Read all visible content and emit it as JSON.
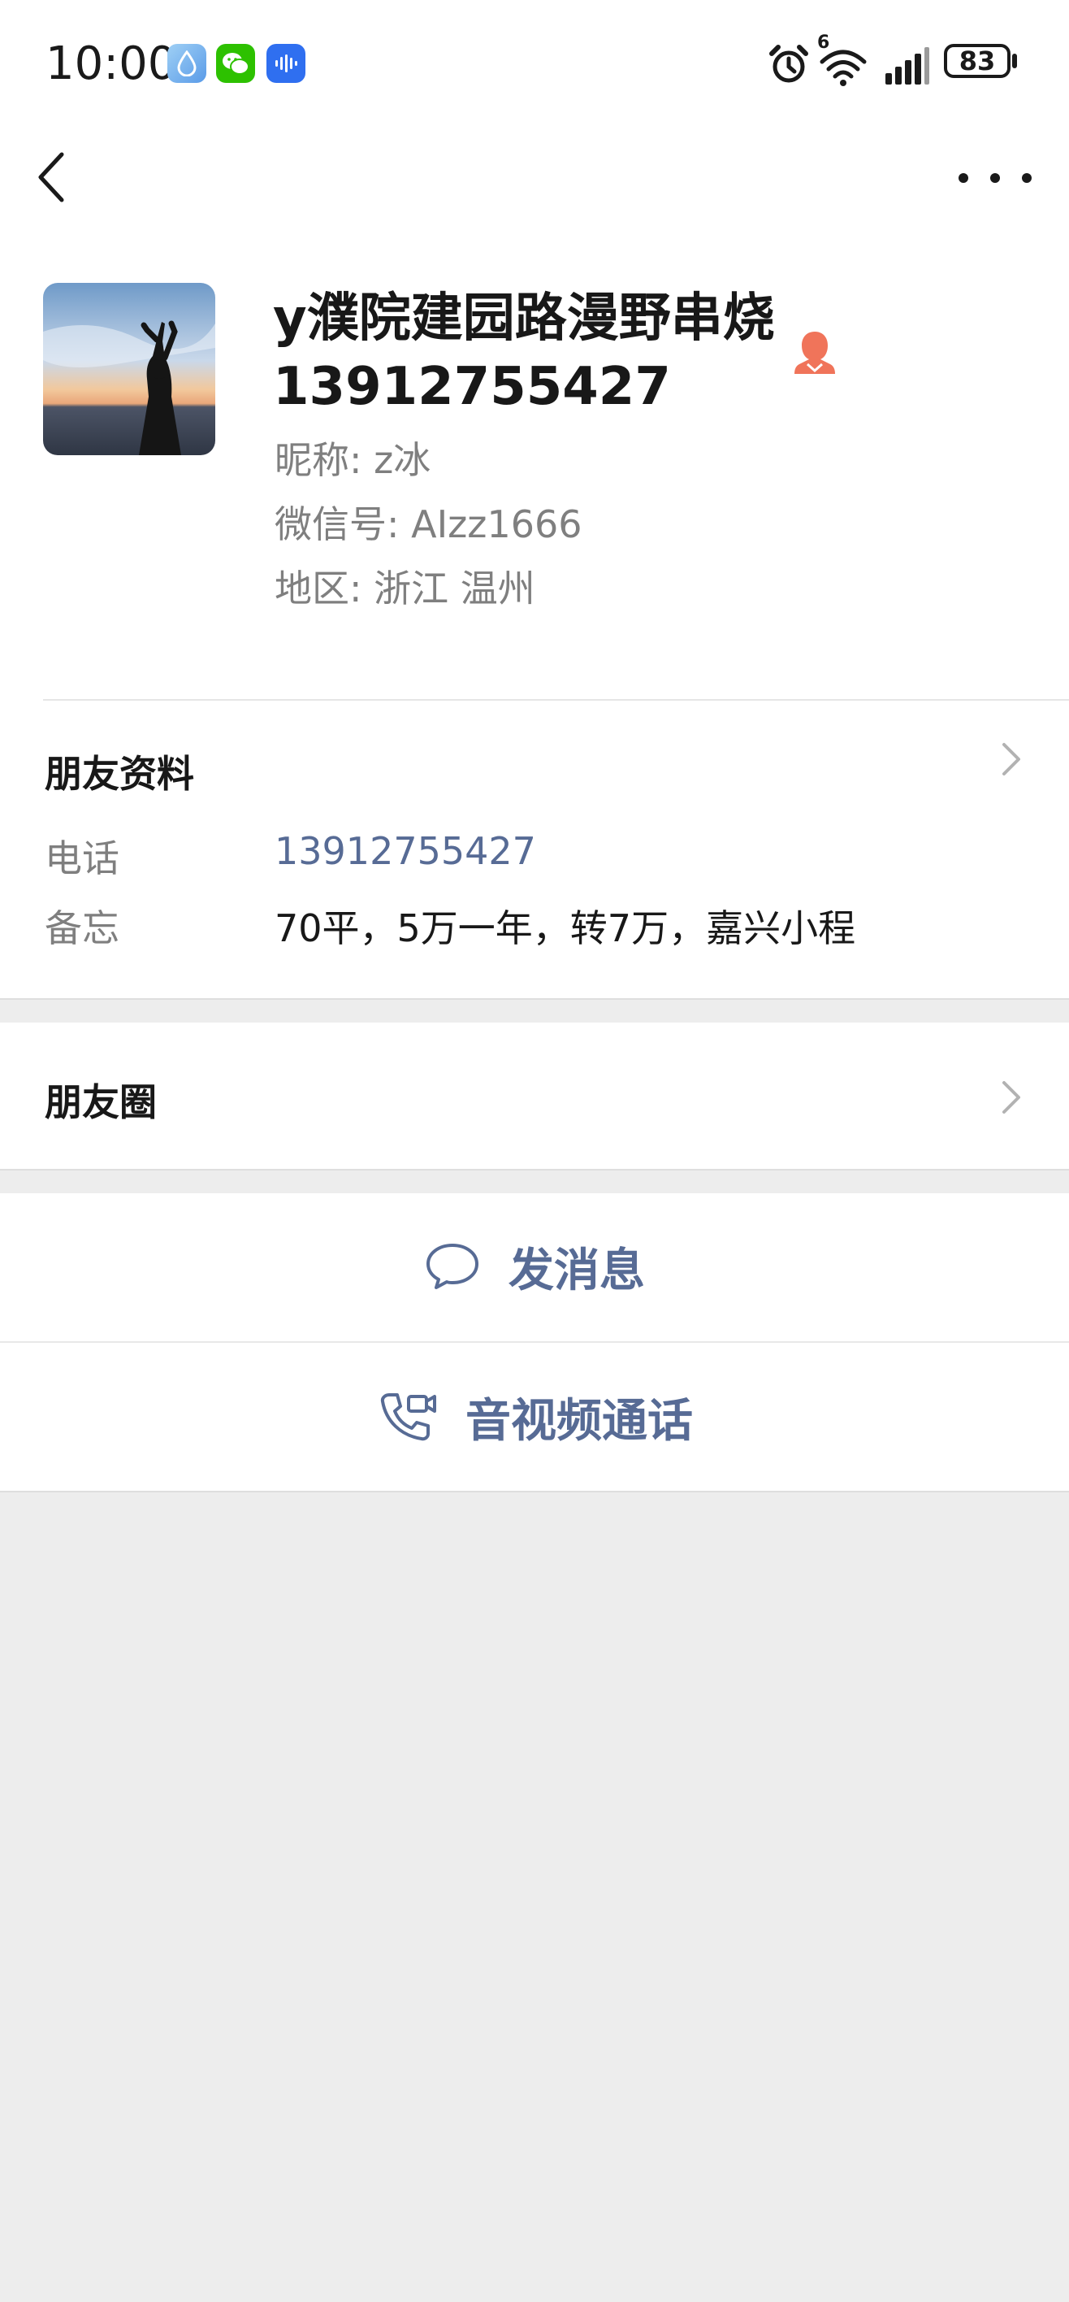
{
  "status_bar": {
    "time": "10:00",
    "battery": "83",
    "signal_label": "6",
    "icons": [
      "drop-app-icon",
      "wechat-app-icon",
      "voice-app-icon",
      "alarm-icon",
      "wifi-icon",
      "signal-icon",
      "battery-icon"
    ]
  },
  "nav": {
    "back_icon": "chevron-left-icon",
    "more_icon": "more-dots-icon"
  },
  "profile": {
    "name_line1": "y濮院建园路漫野串烧",
    "name_line2": "13912755427",
    "nickname": "昵称: z冰",
    "wechat_id": "微信号: AIzz1666",
    "region": "地区: 浙江  温州",
    "gender_icon": "female-icon"
  },
  "friend_info": {
    "title": "朋友资料",
    "phone_label": "电话",
    "phone_value": "13912755427",
    "memo_label": "备忘",
    "memo_value": "70平，5万一年，转7万，嘉兴小程"
  },
  "moments": {
    "title": "朋友圈"
  },
  "actions": {
    "message": "发消息",
    "call": "音视频通话"
  },
  "colors": {
    "link": "#576b95",
    "background": "#ededed",
    "gender_female": "#f0745a"
  }
}
